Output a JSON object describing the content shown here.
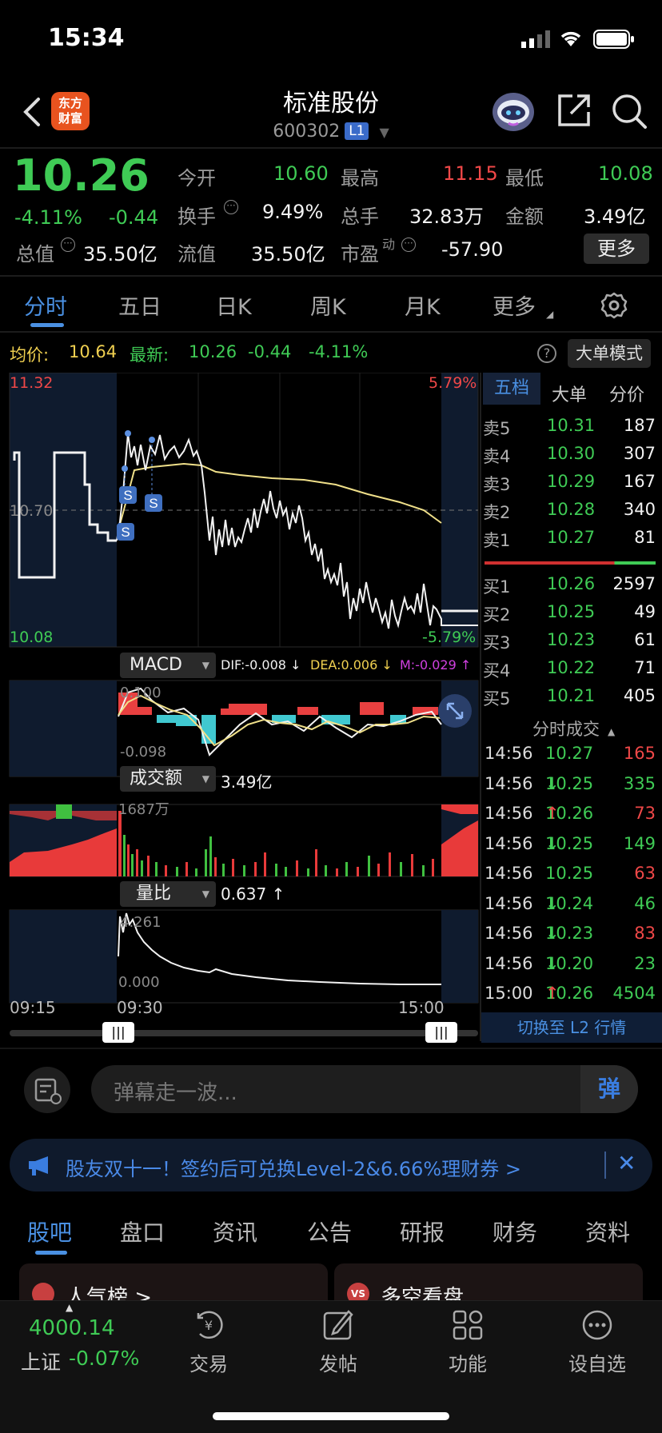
{
  "status_bar": {
    "time": "15:34"
  },
  "header": {
    "app_logo_line1": "东方",
    "app_logo_line2": "财富",
    "stock_name": "标准股份",
    "stock_code": "600302",
    "level_badge": "L1"
  },
  "quote": {
    "price": "10.26",
    "change_pct": "-4.11%",
    "change": "-0.44",
    "fields": {
      "open_label": "今开",
      "open": "10.60",
      "high_label": "最高",
      "high": "11.15",
      "low_label": "最低",
      "low": "10.08",
      "turnover_label": "换手",
      "turnover": "9.49%",
      "volume_label": "总手",
      "volume": "32.83万",
      "amount_label": "金额",
      "amount": "3.49亿",
      "mktcap_label": "总值",
      "mktcap": "35.50亿",
      "float_label": "流值",
      "float": "35.50亿",
      "pe_label": "市盈",
      "pe_sup": "动",
      "pe": "-57.90"
    },
    "more_button": "更多"
  },
  "period_tabs": [
    "分时",
    "五日",
    "日K",
    "周K",
    "月K",
    "更多"
  ],
  "chart_info": {
    "avg_label": "均价:",
    "avg": "10.64",
    "latest_label": "最新:",
    "latest": "10.26",
    "latest_change": "-0.44",
    "latest_pct": "-4.11%",
    "big_order_mode": "大单模式"
  },
  "price_axis": {
    "top": "11.32",
    "mid": "10.70",
    "bottom": "10.08",
    "top_pct": "5.79%",
    "bottom_pct": "-5.79%"
  },
  "macd": {
    "label": "MACD",
    "dif": "DIF:-0.008 ↓",
    "dea": "DEA:0.006 ↓",
    "m": "M:-0.029 ↑",
    "top": "0.100",
    "bottom": "-0.098"
  },
  "amount_panel": {
    "label": "成交额",
    "value": "3.49亿",
    "max": "1687万"
  },
  "volume_ratio": {
    "label": "量比",
    "value": "0.637 ↑",
    "max": "4.261",
    "min": "0.000"
  },
  "time_axis": {
    "start": "09:15",
    "open": "09:30",
    "end": "15:00"
  },
  "order_book": {
    "tabs": [
      "五档",
      "大单",
      "分价"
    ],
    "asks": [
      {
        "label": "卖5",
        "price": "10.31",
        "vol": "187"
      },
      {
        "label": "卖4",
        "price": "10.30",
        "vol": "307"
      },
      {
        "label": "卖3",
        "price": "10.29",
        "vol": "167"
      },
      {
        "label": "卖2",
        "price": "10.28",
        "vol": "340"
      },
      {
        "label": "卖1",
        "price": "10.27",
        "vol": "81"
      }
    ],
    "bids": [
      {
        "label": "买1",
        "price": "10.26",
        "vol": "2597"
      },
      {
        "label": "买2",
        "price": "10.25",
        "vol": "49"
      },
      {
        "label": "买3",
        "price": "10.23",
        "vol": "61"
      },
      {
        "label": "买4",
        "price": "10.22",
        "vol": "71"
      },
      {
        "label": "买5",
        "price": "10.21",
        "vol": "405"
      }
    ]
  },
  "ticks": {
    "title": "分时成交",
    "rows": [
      {
        "time": "14:56",
        "price": "10.27",
        "arrow": "",
        "vol": "165",
        "vcolor": "red"
      },
      {
        "time": "14:56",
        "price": "10.25",
        "arrow": "↓",
        "vol": "335",
        "vcolor": "green"
      },
      {
        "time": "14:56",
        "price": "10.26",
        "arrow": "↑",
        "vol": "73",
        "vcolor": "red"
      },
      {
        "time": "14:56",
        "price": "10.25",
        "arrow": "↓",
        "vol": "149",
        "vcolor": "green"
      },
      {
        "time": "14:56",
        "price": "10.25",
        "arrow": "",
        "vol": "63",
        "vcolor": "red"
      },
      {
        "time": "14:56",
        "price": "10.24",
        "arrow": "↓",
        "vol": "46",
        "vcolor": "green"
      },
      {
        "time": "14:56",
        "price": "10.23",
        "arrow": "↓",
        "vol": "83",
        "vcolor": "red"
      },
      {
        "time": "14:56",
        "price": "10.20",
        "arrow": "↓",
        "vol": "23",
        "vcolor": "green"
      },
      {
        "time": "15:00",
        "price": "10.26",
        "arrow": "↑",
        "vol": "4504",
        "vcolor": "green"
      }
    ],
    "switch_l2": "切换至 L2 行情"
  },
  "comment": {
    "placeholder": "弹幕走一波...",
    "danmu_label": "弹"
  },
  "banner": {
    "text": "股友双十一！签约后可兑换Level-2&6.66%理财券 >"
  },
  "bottom_tabs": [
    "股吧",
    "盘口",
    "资讯",
    "公告",
    "研报",
    "财务",
    "资料"
  ],
  "cards": {
    "left": "人气榜 >",
    "right": "多空看盘"
  },
  "bottom_nav": {
    "index_value": "4000.14",
    "index_name": "上证",
    "index_change": "-0.07%",
    "items": [
      "交易",
      "发帖",
      "功能",
      "设自选"
    ]
  },
  "colors": {
    "up": "#f04848",
    "down": "#3fcb55",
    "avg_line": "#f0e08a",
    "accent": "#4a90e2"
  }
}
